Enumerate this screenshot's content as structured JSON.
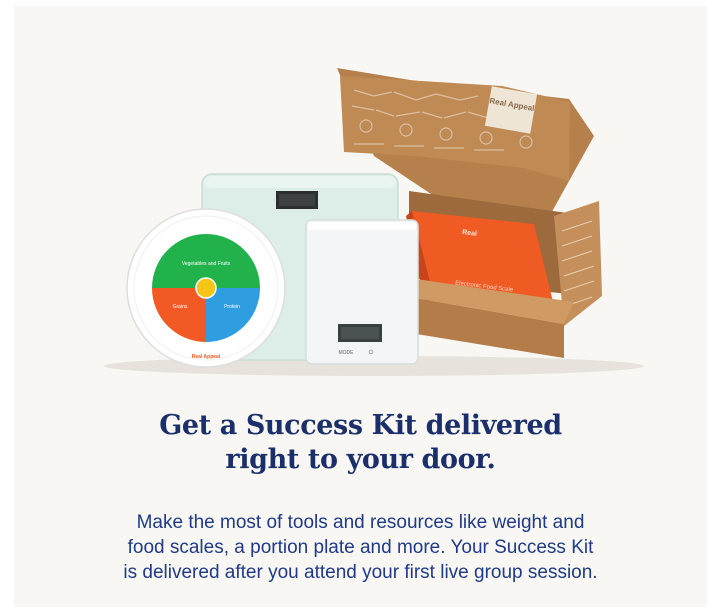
{
  "hero": {
    "image": {
      "plate_labels": {
        "top": "Vegetables and Fruits",
        "left": "Grains",
        "right": "Protein",
        "brand": "Real Appeal"
      },
      "box_brand": "Real Appeal",
      "kitchen_scale_buttons": [
        "MODE",
        "⏻"
      ],
      "orange_box_label": "Electronic Food Scale"
    },
    "headline_line1": "Get a Success Kit delivered",
    "headline_line2": "right to your door.",
    "body_line1": "Make the most of tools and resources like weight and",
    "body_line2": "food scales, a portion plate and more. Your Success Kit",
    "body_line3": "is delivered after you attend your first live group session."
  },
  "colors": {
    "card_bg": "#f9f7f3",
    "headline": "#1b2f6b",
    "body": "#1f3a86",
    "plate_green": "#22b24c",
    "plate_orange": "#f15a24",
    "plate_blue": "#2f9ee0",
    "plate_center": "#f5c518",
    "box_brown": "#b9834e",
    "box_orange": "#f05a23",
    "scale_mint": "#dbece6"
  }
}
